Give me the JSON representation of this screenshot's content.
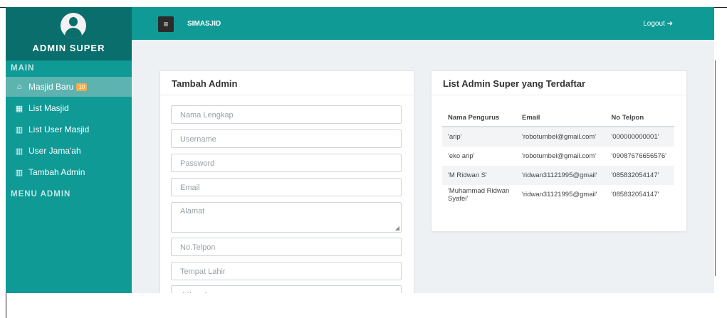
{
  "sidebar": {
    "brand_title": "ADMIN SUPER",
    "section_main": "MAIN",
    "section_menu_admin": "MENU ADMIN",
    "items": [
      {
        "label": "Masjid Baru",
        "icon": "home-icon",
        "badge": "10",
        "active": true
      },
      {
        "label": "List Masjid",
        "icon": "building-icon"
      },
      {
        "label": "List User Masjid",
        "icon": "bar-chart-icon"
      },
      {
        "label": "User Jama'ah",
        "icon": "bar-chart-icon"
      },
      {
        "label": "Tambah Admin",
        "icon": "bar-chart-icon"
      }
    ]
  },
  "topbar": {
    "app_name": "SIMASJID",
    "logout_label": "Logout"
  },
  "form_card": {
    "title": "Tambah Admin",
    "fields": {
      "nama_lengkap": "Nama Lengkap",
      "username": "Username",
      "password": "Password",
      "email": "Email",
      "alamat": "Alamat",
      "no_telpon": "No.Telpon",
      "tempat_lahir": "Tempat Lahir",
      "tanggal_lahir": "dd/mm/yyyy"
    }
  },
  "list_card": {
    "title": "List Admin Super yang Terdaftar",
    "columns": [
      "Nama Pengurus",
      "Email",
      "No Telpon"
    ],
    "rows": [
      [
        "'arip'",
        "'robotumbel@gmail.com'",
        "'000000000001'"
      ],
      [
        "'eko arip'",
        "'robotumbel@gmail.com'",
        "'09087676656576'"
      ],
      [
        "'M Ridwan S'",
        "'ridwan31121995@gmail'",
        "'085832054147'"
      ],
      [
        "'Muhammad Ridwan Syafei'",
        "'ridwan31121995@gmail'",
        "'085832054147'"
      ]
    ]
  },
  "colors": {
    "sidebar": "#0f9a96",
    "brand": "#0a6e6c",
    "active_item": "#5cb3b0",
    "badge": "#f0ad4e"
  }
}
